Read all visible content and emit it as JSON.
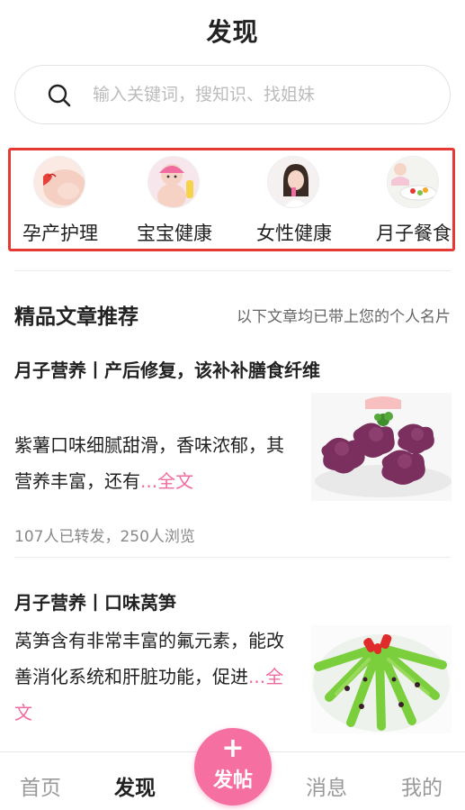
{
  "header": {
    "title": "发现"
  },
  "search": {
    "placeholder": "输入关键词，搜知识、找姐妹"
  },
  "categories": [
    {
      "label": "孕产护理",
      "icon": "pregnancy-care-icon"
    },
    {
      "label": "宝宝健康",
      "icon": "baby-health-icon"
    },
    {
      "label": "女性健康",
      "icon": "female-health-icon"
    },
    {
      "label": "月子餐食",
      "icon": "confinement-meal-icon"
    }
  ],
  "section": {
    "title": "精品文章推荐",
    "note": "以下文章均已带上您的个人名片"
  },
  "articles": [
    {
      "title": "月子营养丨产后修复，该补补膳食纤维",
      "text": "紫薯口味细腻甜滑，香味浓郁，其营养丰富，还有",
      "more": "...全文",
      "stats": "107人已转发，250人浏览",
      "image": "purple-sweet-potato-cake-photo"
    },
    {
      "title": "月子营养丨口味莴笋",
      "text": "莴笋含有非常丰富的氟元素，能改善消化系统和肝脏功能，促进",
      "more": "...全文",
      "image": "lettuce-stem-dish-photo"
    }
  ],
  "tabbar": {
    "home": "首页",
    "discover": "发现",
    "post_plus": "+",
    "post": "发帖",
    "messages": "消息",
    "mine": "我的"
  },
  "colors": {
    "accent_pink": "#f56fa1",
    "link_pink": "#f06ba0",
    "highlight_red": "#e53935"
  }
}
